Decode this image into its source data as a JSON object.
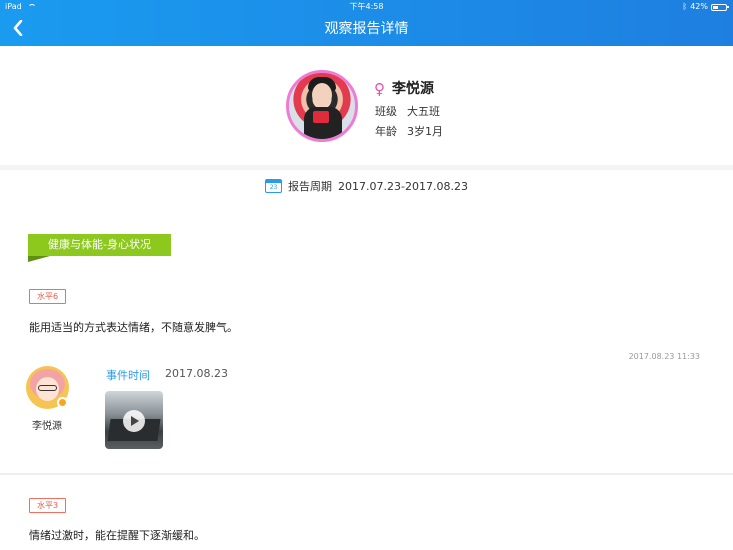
{
  "status_bar": {
    "device": "iPad",
    "time": "下午4:58",
    "battery": "42%",
    "battery_level": 0.42
  },
  "nav": {
    "title": "观察报告详情",
    "back_icon": "chevron-left-icon"
  },
  "profile": {
    "name": "李悦源",
    "gender_icon": "female-icon",
    "class_label": "班级",
    "class_value": "大五班",
    "age_label": "年龄",
    "age_value": "3岁1月"
  },
  "period": {
    "icon": "calendar-icon",
    "calendar_day": "23",
    "label": "报告周期",
    "value": "2017.07.23-2017.08.23"
  },
  "category": {
    "title": "健康与体能-身心状况"
  },
  "entries": [
    {
      "level": "水平6",
      "description": "能用适当的方式表达情绪，不随意发脾气。",
      "timestamp": "2017.08.23 11:33",
      "author": "李悦源",
      "event_label": "事件时间",
      "event_date": "2017.08.23"
    },
    {
      "level": "水平3",
      "description": "情绪过激时，能在提醒下逐渐缓和。"
    }
  ],
  "colors": {
    "nav_blue": "#1e8ae8",
    "category_green": "#8dc81e",
    "level_red": "#e85a48",
    "link_blue": "#2a9be8",
    "gender_pink": "#e84ea8"
  }
}
